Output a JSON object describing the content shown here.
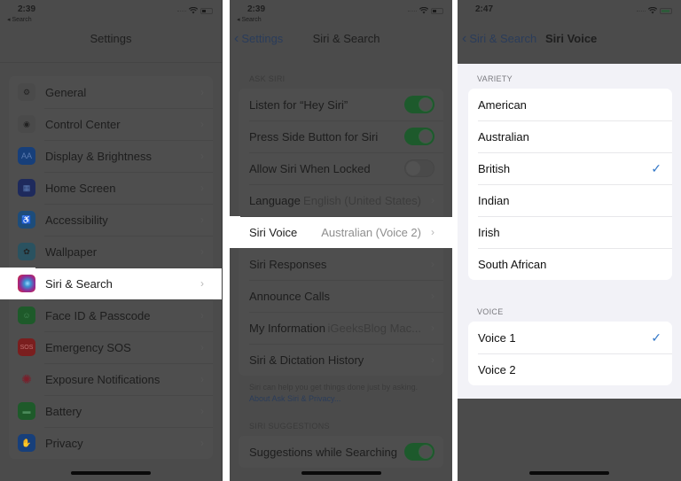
{
  "panel1": {
    "status": {
      "time": "2:39",
      "back_app": "◂ Search"
    },
    "title": "Settings",
    "items": [
      {
        "label": "General",
        "icon": "gear-icon",
        "icon_glyph": "⚙",
        "icon_color": "#4a4a4a"
      },
      {
        "label": "Control Center",
        "icon": "toggles-icon",
        "icon_glyph": "◉",
        "icon_color": "#4a4a4a"
      },
      {
        "label": "Display & Brightness",
        "icon": "display-icon",
        "icon_glyph": "AA",
        "icon_color": "#173f7a"
      },
      {
        "label": "Home Screen",
        "icon": "home-grid-icon",
        "icon_glyph": "▦",
        "icon_color": "#1e2a5c"
      },
      {
        "label": "Accessibility",
        "icon": "accessibility-icon",
        "icon_glyph": "♿",
        "icon_color": "#1d4c7a"
      },
      {
        "label": "Wallpaper",
        "icon": "wallpaper-icon",
        "icon_glyph": "✿",
        "icon_color": "#2a5260"
      },
      {
        "label": "Siri & Search",
        "icon": "siri-icon",
        "icon_glyph": "",
        "icon_color": "#6a2a6a",
        "highlighted": true
      },
      {
        "label": "Face ID & Passcode",
        "icon": "face-id-icon",
        "icon_glyph": "☺",
        "icon_color": "#1e5a2a"
      },
      {
        "label": "Emergency SOS",
        "icon": "sos-icon",
        "icon_glyph": "SOS",
        "icon_color": "#7a1e1e"
      },
      {
        "label": "Exposure Notifications",
        "icon": "exposure-icon",
        "icon_glyph": "✺",
        "icon_color": "transparent"
      },
      {
        "label": "Battery",
        "icon": "battery-icon",
        "icon_glyph": "▬",
        "icon_color": "#1e5a2a"
      },
      {
        "label": "Privacy",
        "icon": "hand-icon",
        "icon_glyph": "✋",
        "icon_color": "#173f7a"
      }
    ]
  },
  "panel2": {
    "status": {
      "time": "2:39",
      "back_app": "◂ Search"
    },
    "back_label": "Settings",
    "title": "Siri & Search",
    "ask_siri_header": "ASK SIRI",
    "ask_siri_rows": [
      {
        "label": "Listen for “Hey Siri”",
        "type": "toggle",
        "on": true
      },
      {
        "label": "Press Side Button for Siri",
        "type": "toggle",
        "on": true
      },
      {
        "label": "Allow Siri When Locked",
        "type": "toggle",
        "on": false
      },
      {
        "label": "Language",
        "type": "link",
        "value": "English (United States)"
      },
      {
        "label": "Siri Voice",
        "type": "link",
        "value": "Australian (Voice 2)",
        "highlighted": true
      },
      {
        "label": "Siri Responses",
        "type": "link",
        "value": ""
      },
      {
        "label": "Announce Calls",
        "type": "link",
        "value": ""
      },
      {
        "label": "My Information",
        "type": "link",
        "value": "iGeeksBlog Mac..."
      },
      {
        "label": "Siri & Dictation History",
        "type": "link",
        "value": ""
      }
    ],
    "footer_text": "Siri can help you get things done just by asking.",
    "footer_link": "About Ask Siri & Privacy...",
    "suggestions_header": "SIRI SUGGESTIONS",
    "suggestions_rows": [
      {
        "label": "Suggestions while Searching",
        "type": "toggle",
        "on": true
      }
    ]
  },
  "panel3": {
    "status": {
      "time": "2:47"
    },
    "back_label": "Siri & Search",
    "title": "Siri Voice",
    "variety_header": "VARIETY",
    "variety": [
      {
        "label": "American",
        "selected": false
      },
      {
        "label": "Australian",
        "selected": false
      },
      {
        "label": "British",
        "selected": true
      },
      {
        "label": "Indian",
        "selected": false
      },
      {
        "label": "Irish",
        "selected": false
      },
      {
        "label": "South African",
        "selected": false
      }
    ],
    "voice_header": "VOICE",
    "voices": [
      {
        "label": "Voice 1",
        "selected": true
      },
      {
        "label": "Voice 2",
        "selected": false
      }
    ],
    "check_glyph": "✓"
  },
  "glyphs": {
    "chevron_right": "›",
    "chevron_left": "‹"
  },
  "colors": {
    "accent": "#3478c8",
    "toggle_on": "#1d5a2c"
  }
}
